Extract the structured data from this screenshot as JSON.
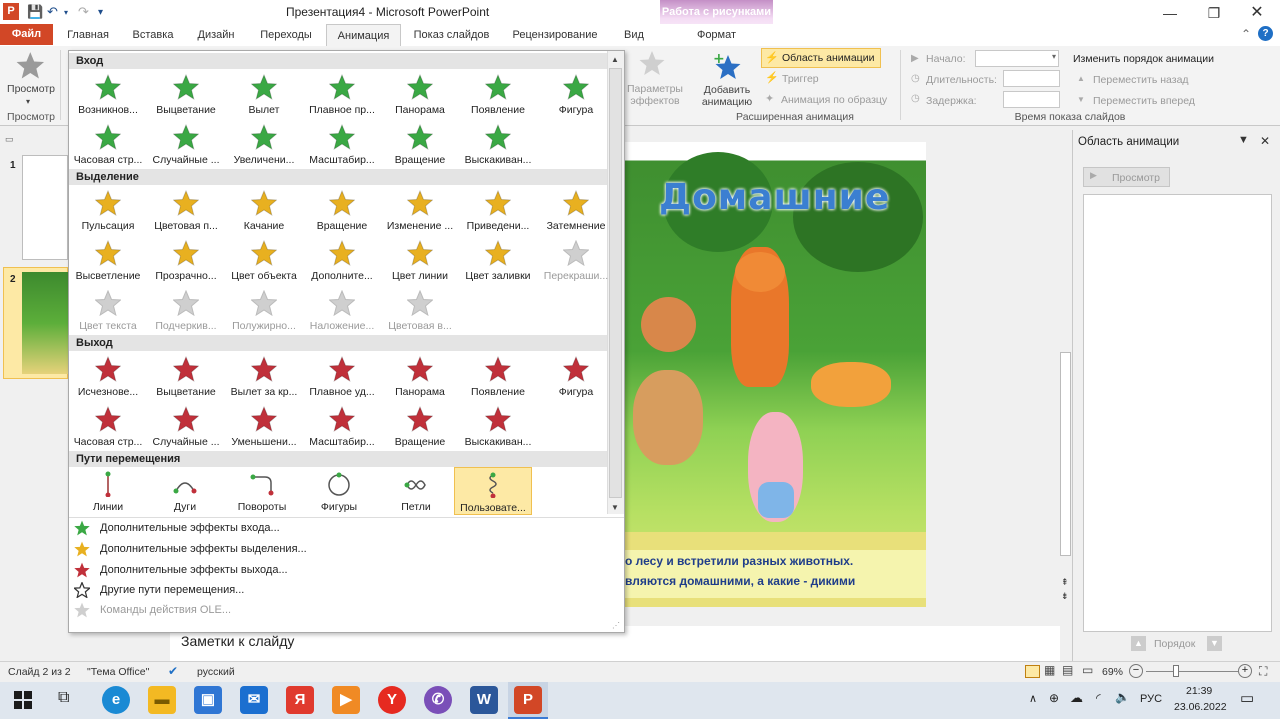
{
  "window": {
    "title": "Презентация4 - Microsoft PowerPoint",
    "app_icon": "P",
    "contextual_group": "Работа с рисунками",
    "contextual_tab": "Формат"
  },
  "tabs": [
    "Файл",
    "Главная",
    "Вставка",
    "Дизайн",
    "Переходы",
    "Анимация",
    "Показ слайдов",
    "Рецензирование",
    "Вид"
  ],
  "ribbon": {
    "preview_label": "Просмотр",
    "preview_group": "Просмотр",
    "effect_options": "Параметры эффектов",
    "add_animation": "Добавить анимацию",
    "animation_pane": "Область анимации",
    "trigger": "Триггер",
    "anim_painter": "Анимация по образцу",
    "advanced_group": "Расширенная анимация",
    "start_label": "Начало:",
    "duration_label": "Длительность:",
    "delay_label": "Задержка:",
    "reorder_title": "Изменить порядок анимации",
    "move_back": "Переместить назад",
    "move_forward": "Переместить вперед",
    "timing_group": "Время показа слайдов"
  },
  "gallery": {
    "entrance_title": "Вход",
    "entrance": [
      "Возникнов...",
      "Выцветание",
      "Вылет",
      "Плавное пр...",
      "Панорама",
      "Появление",
      "Фигура",
      "Часовая стр...",
      "Случайные ...",
      "Увеличени...",
      "Масштабир...",
      "Вращение",
      "Выскакиван..."
    ],
    "emphasis_title": "Выделение",
    "emphasis": [
      "Пульсация",
      "Цветовая п...",
      "Качание",
      "Вращение",
      "Изменение ...",
      "Приведени...",
      "Затемнение",
      "Высветление",
      "Прозрачно...",
      "Цвет объекта",
      "Дополните...",
      "Цвет линии",
      "Цвет заливки",
      "Перекраши...",
      "Цвет текста",
      "Подчеркив...",
      "Полужирно...",
      "Наложение...",
      "Цветовая в..."
    ],
    "exit_title": "Выход",
    "exit": [
      "Исчезнове...",
      "Выцветание",
      "Вылет за кр...",
      "Плавное уд...",
      "Панорама",
      "Появление",
      "Фигура",
      "Часовая стр...",
      "Случайные ...",
      "Уменьшени...",
      "Масштабир...",
      "Вращение",
      "Выскакиван..."
    ],
    "motion_title": "Пути перемещения",
    "motion": [
      "Линии",
      "Дуги",
      "Повороты",
      "Фигуры",
      "Петли",
      "Пользовате..."
    ],
    "more": [
      "Дополнительные эффекты входа...",
      "Дополнительные эффекты выделения...",
      "Дополнительные эффекты выхода...",
      "Другие пути перемещения...",
      "Команды действия OLE..."
    ]
  },
  "slide": {
    "title": "Домашние",
    "caption1": "о лесу и встретили разных животных.",
    "caption2": "вляются домашними, а какие - дикими"
  },
  "thumbs": [
    "1",
    "2"
  ],
  "taskpane": {
    "title": "Область анимации",
    "play": "Просмотр",
    "order": "Порядок"
  },
  "notes_placeholder": "Заметки к слайду",
  "status": {
    "slide": "Слайд 2 из 2",
    "theme": "\"Тема Office\"",
    "lang": "русский",
    "zoom": "69%"
  },
  "taskbar": {
    "lang": "РУС",
    "time": "21:39",
    "date": "23.06.2022"
  },
  "colors": {
    "file_tab": "#d24726",
    "entrance": "#3aa844",
    "emphasis": "#e8b020",
    "exit": "#c0303a"
  }
}
